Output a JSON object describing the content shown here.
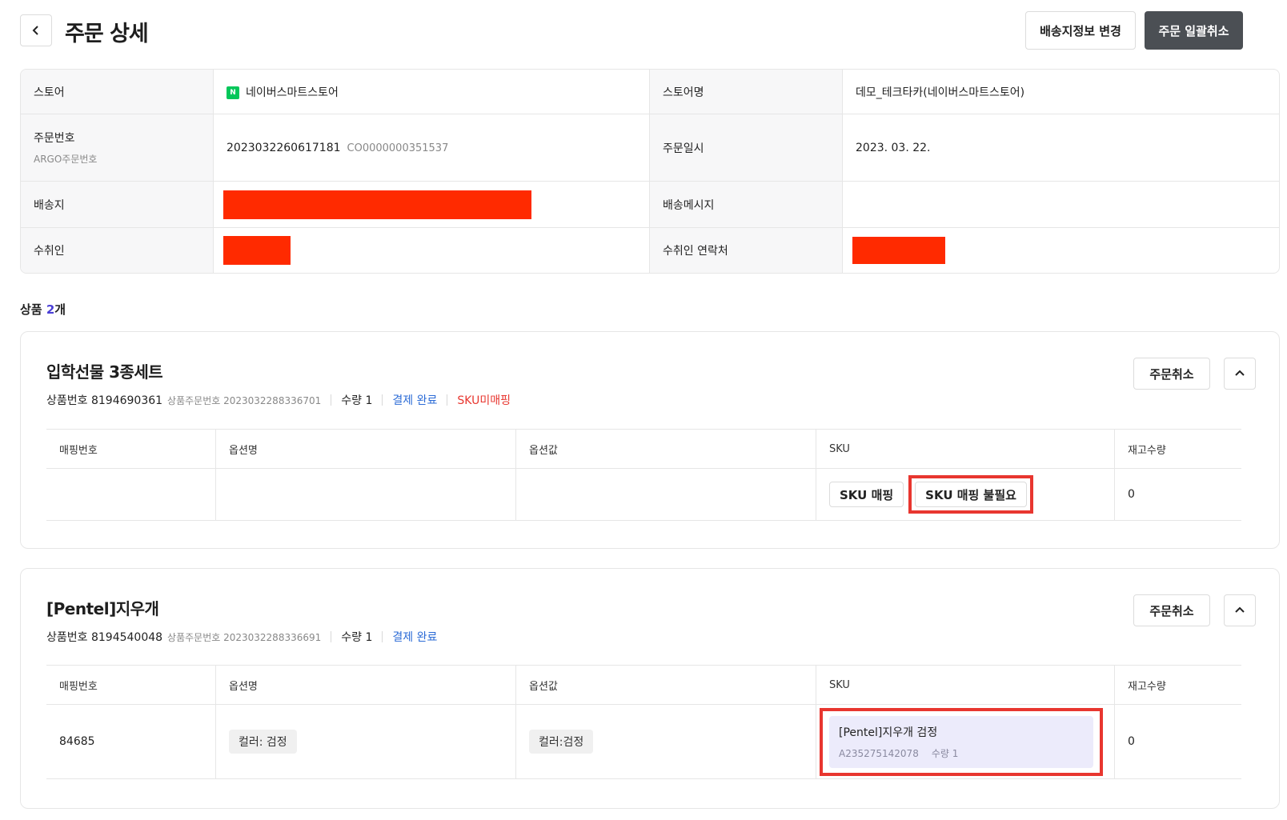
{
  "header": {
    "title": "주문 상세",
    "btn_change_delivery": "배송지정보 변경",
    "btn_cancel_all": "주문 일괄취소"
  },
  "info": {
    "store_label": "스토어",
    "store_value": "네이버스마트스토어",
    "store_logo": "N",
    "store_name_label": "스토어명",
    "store_name_value": "데모_테크타카(네이버스마트스토어)",
    "order_no_label": "주문번호",
    "argo_label": "ARGO주문번호",
    "order_no_value": "2023032260617181",
    "argo_value": "CO0000000351537",
    "order_date_label": "주문일시",
    "order_date_value": "2023. 03. 22.",
    "address_label": "배송지",
    "delivery_msg_label": "배송메시지",
    "recipient_label": "수취인",
    "recipient_phone_label": "수취인 연락처",
    "redaction_color": "#ff2a00"
  },
  "products": {
    "label": "상품",
    "count": "2",
    "unit": "개"
  },
  "table_headers": {
    "mapping_no": "매핑번호",
    "option_name": "옵션명",
    "option_value": "옵션값",
    "sku": "SKU",
    "stock": "재고수량"
  },
  "product1": {
    "title": "입학선물 3종세트",
    "product_no": "상품번호 8194690361",
    "product_order_no": "상품주문번호 2023032288336701",
    "qty": "수량 1",
    "payment": "결제 완료",
    "sku_status": "SKU미매핑",
    "cancel_btn": "주문취소",
    "row": {
      "mapping_no": "",
      "option_name": "",
      "option_value": "",
      "btn_sku_mapping": "SKU 매핑",
      "btn_sku_not_needed": "SKU 매핑 불필요",
      "stock": "0"
    }
  },
  "product2": {
    "title": "[Pentel]지우개",
    "product_no": "상품번호 8194540048",
    "product_order_no": "상품주문번호 2023032288336691",
    "qty": "수량 1",
    "payment": "결제 완료",
    "cancel_btn": "주문취소",
    "row": {
      "mapping_no": "84685",
      "option_name": "컬러: 검정",
      "option_value": "컬러:검정",
      "sku_name": "[Pentel]지우개 검정",
      "sku_code": "A235275142078",
      "sku_qty": "수량 1",
      "stock": "0"
    }
  },
  "colors": {
    "accent": "#4a3fd6",
    "dark_button": "#4b4f54",
    "link_blue": "#2b6bd6",
    "warning_red": "#e8362f",
    "highlight_box": "#e8362f",
    "sku_card_bg": "#ecebfb"
  }
}
